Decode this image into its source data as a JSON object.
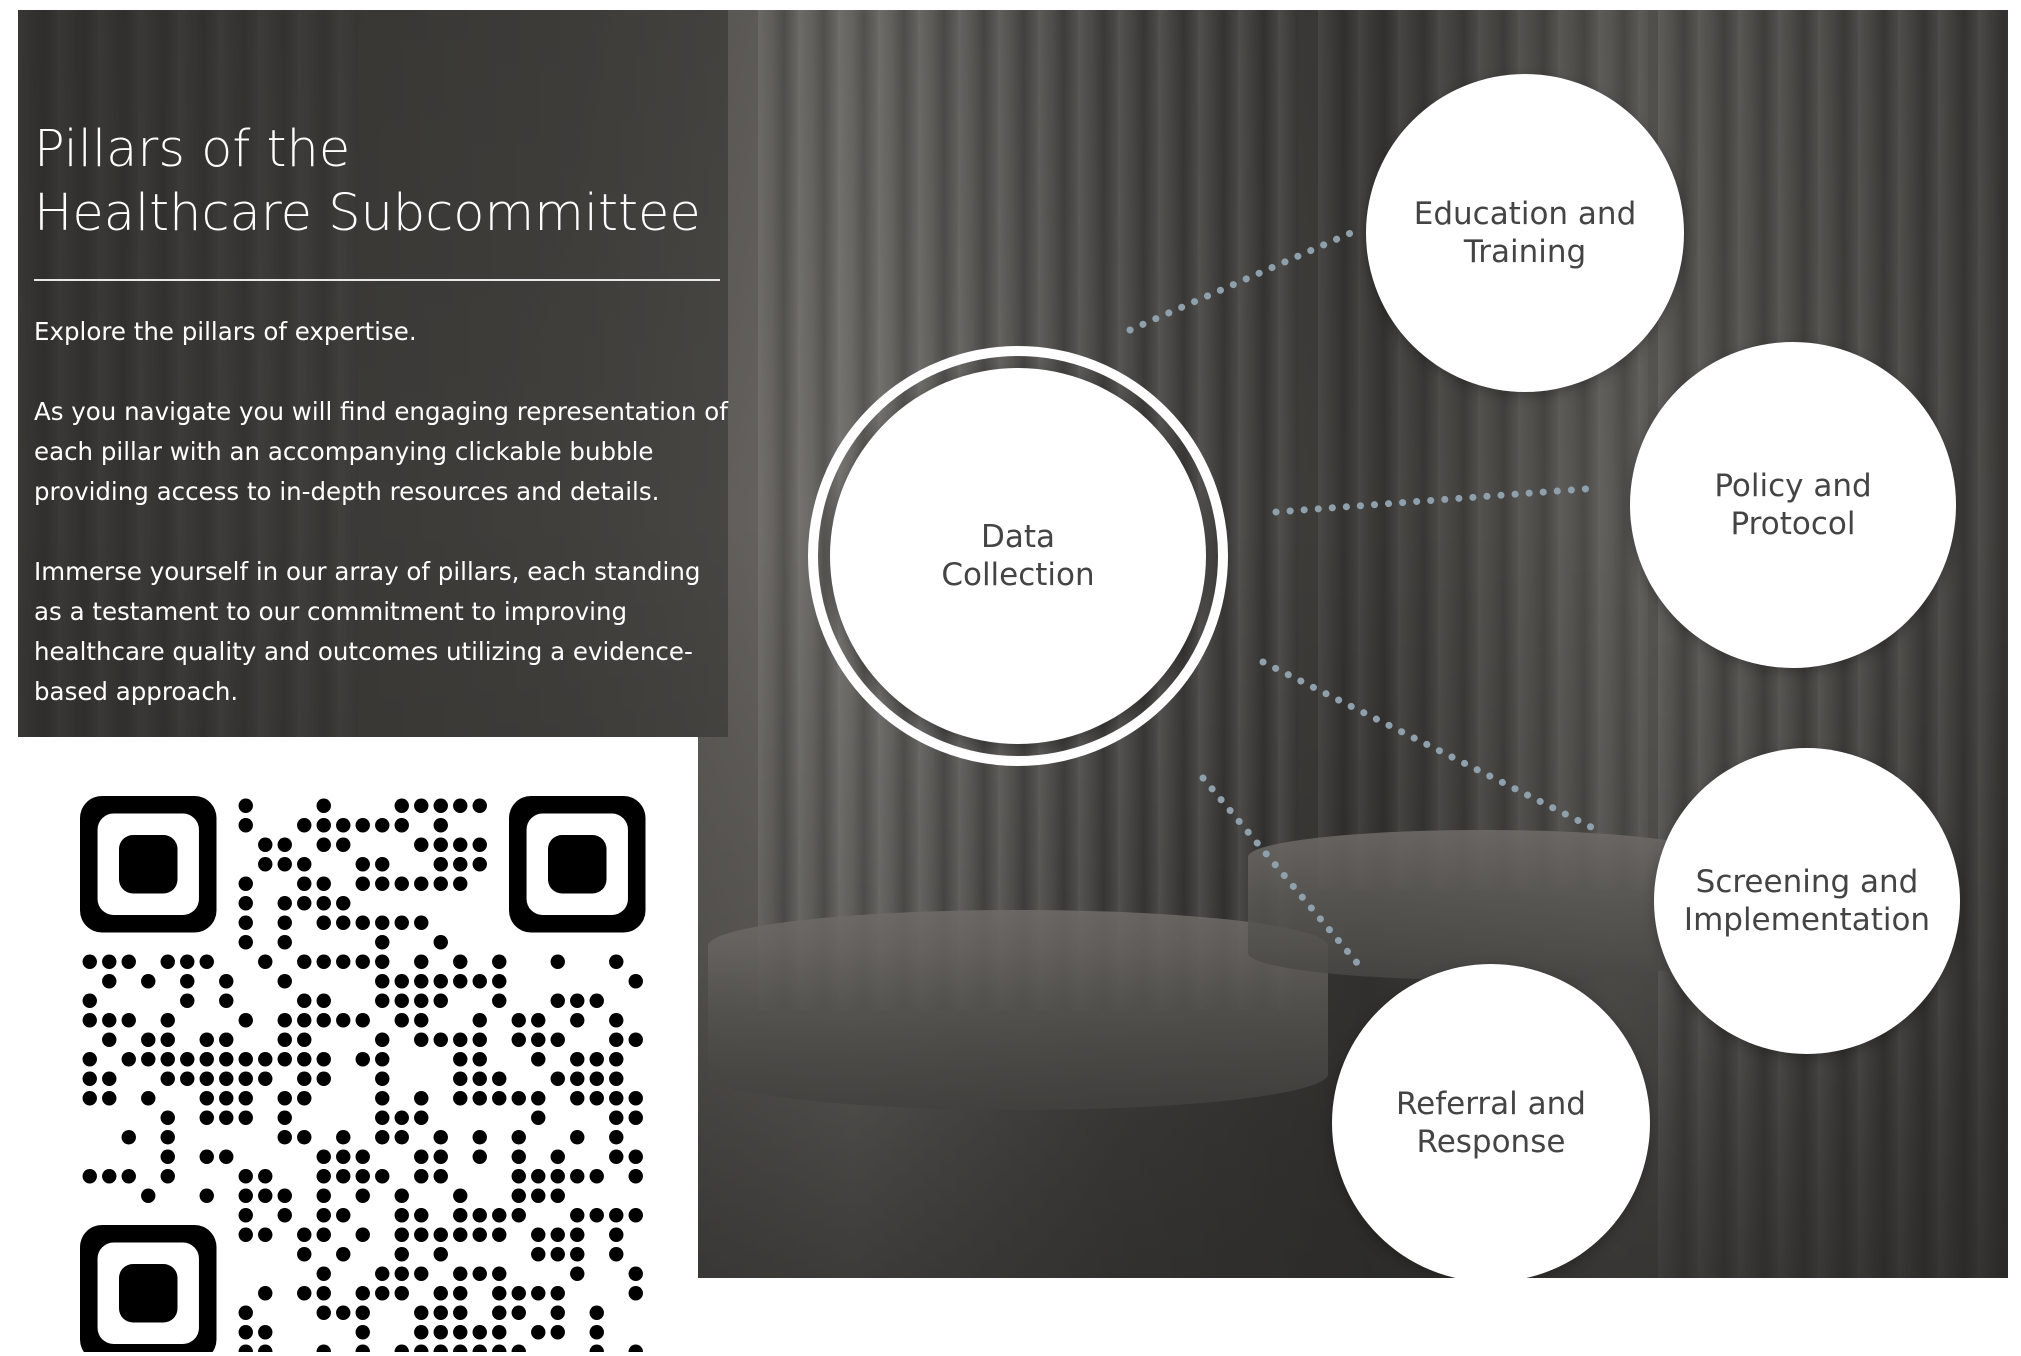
{
  "heading": {
    "title_line1": "Pillars of the",
    "title_line2": "Healthcare Subcommittee"
  },
  "intro": {
    "p1": "Explore the pillars of expertise.",
    "p2": "As you navigate you will find engaging representation of each pillar with an accompanying clickable bubble providing access to in-depth resources and details.",
    "p3": "Immerse yourself in our array of pillars, each standing as a testament to our commitment to improving healthcare quality and  outcomes utilizing a evidence-based approach."
  },
  "bubbles": {
    "center": "Data\nCollection",
    "education": "Education and\nTraining",
    "policy": "Policy and\nProtocol",
    "screening": "Screening and\nImplementation",
    "referral": "Referral and\nResponse"
  },
  "colors": {
    "connector": "#8a9aa6",
    "bubble_fill": "#ffffff",
    "bubble_text": "#444444"
  }
}
